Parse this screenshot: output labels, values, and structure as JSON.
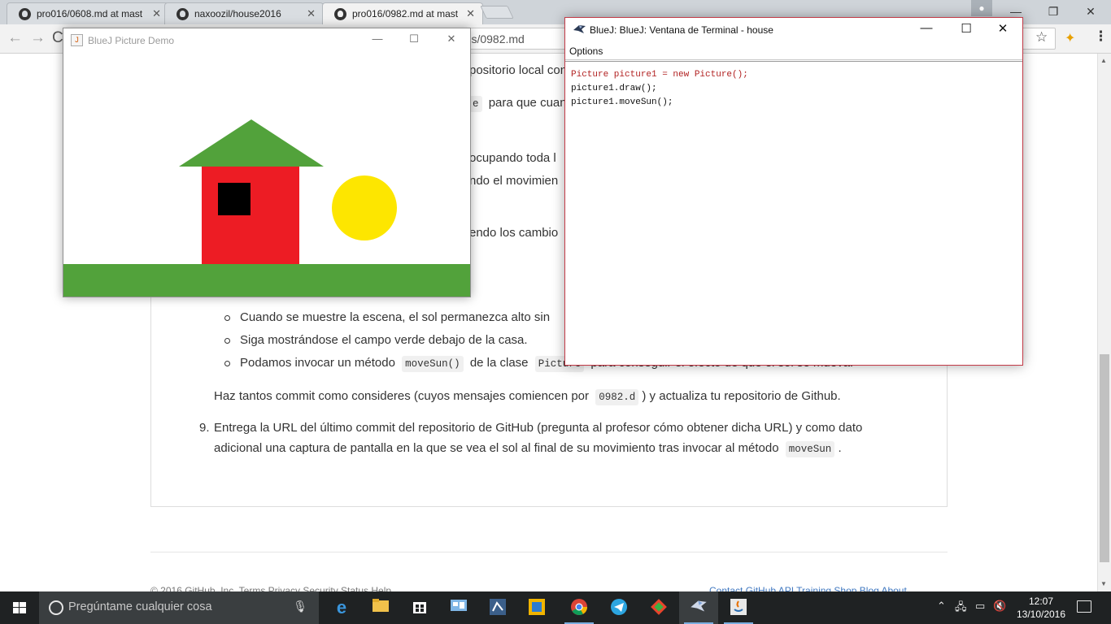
{
  "browser": {
    "tabs": [
      {
        "title": "pro016/0608.md at mast",
        "active": false
      },
      {
        "title": "naxoozil/house2016",
        "active": false
      },
      {
        "title": "pro016/0982.md at mast",
        "active": true
      }
    ],
    "url": "lades/0982.md"
  },
  "page": {
    "line1": "positorio local con",
    "line2a": "e",
    "line2b": "para que cuan",
    "line3": "ocupando toda l",
    "line4": "ndo el movimien",
    "line5": "endo los cambio",
    "bullets": [
      "Cuando se muestre la escena, el sol permanezca alto sin",
      "Siga mostrándose el campo verde debajo de la casa."
    ],
    "bullet3_pre": "Podamos invocar un método",
    "bullet3_code1": "moveSun()",
    "bullet3_mid": "de la clase",
    "bullet3_code2": "Picture",
    "bullet3_post": "para conseguir el efecto de que el sol se mueva.",
    "commit_pre": "Haz tantos commit como consideres (cuyos mensajes comiencen por",
    "commit_code": "0982.d",
    "commit_post": ") y actualiza tu repositorio de Github.",
    "item9_number": "9.",
    "item9_line1": "Entrega la URL del último commit del repositorio de GitHub (pregunta al profesor cómo obtener dicha URL) y como dato",
    "item9_line2_pre": "adicional una captura de pantalla en la que se vea el sol al final de su movimiento tras invocar al método",
    "item9_code": "moveSun",
    "item9_line2_post": ".",
    "footer_left": "© 2016 GitHub, Inc.   Terms   Privacy   Security   Status   Help",
    "footer_right": "Contact GitHub   API   Training   Shop   Blog   About"
  },
  "picture_window": {
    "title": "BlueJ Picture Demo",
    "colors": {
      "grass": "#52a23b",
      "roof": "#52a23b",
      "wall": "#ed1c24",
      "window": "#000000",
      "sun": "#fde600",
      "sky": "#ffffff"
    }
  },
  "terminal": {
    "title": "BlueJ: BlueJ:  Ventana de Terminal - house",
    "menu": "Options",
    "lines": [
      "Picture picture1 = new Picture();",
      "picture1.draw();",
      "picture1.moveSun();"
    ],
    "colors": {
      "line1": "#b22222",
      "line2": "#111111",
      "line3": "#111111"
    }
  },
  "taskbar": {
    "search_placeholder": "Pregúntame cualquier cosa",
    "time": "12:07",
    "date": "13/10/2016"
  }
}
